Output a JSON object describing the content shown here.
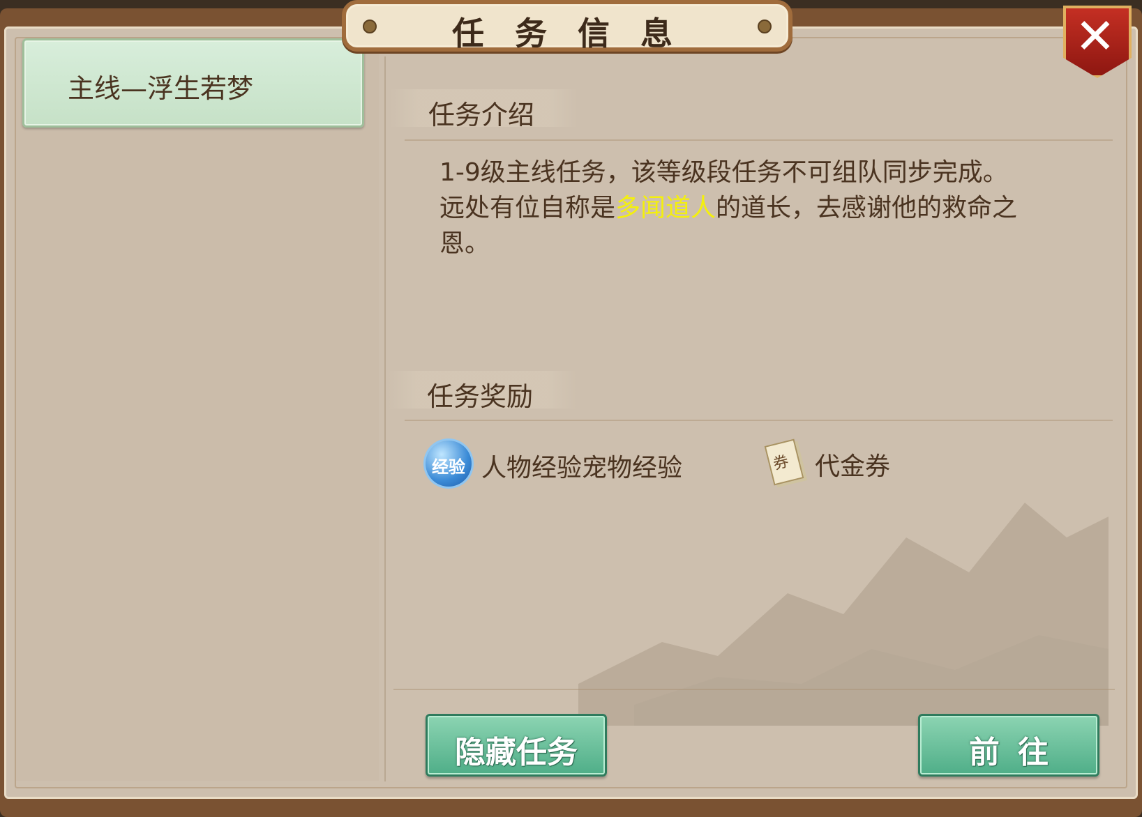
{
  "window": {
    "title": "任 务 信 息",
    "close_icon": "close-x-icon"
  },
  "quest_list": {
    "items": [
      {
        "label": "主线—浮生若梦",
        "selected": true
      }
    ]
  },
  "details": {
    "intro_header": "任务介绍",
    "intro_line1": "1-9级主线任务，该等级段任务不可组队同步完成。",
    "intro_line2_before": "远处有位自称是",
    "intro_highlight": "多闻道人",
    "intro_line2_after": "的道长，去感谢他的救命之",
    "intro_line3": "恩。",
    "rewards_header": "任务奖励",
    "rewards": [
      {
        "icon": "exp-orb-icon",
        "icon_text": "经验",
        "label": "人物经验宠物经验"
      },
      {
        "icon": "voucher-ticket-icon",
        "icon_text": "券",
        "label": "代金券"
      }
    ]
  },
  "actions": {
    "hide_label": "隐藏任务",
    "go_label": "前往"
  },
  "colors": {
    "highlight": "#f4f00c",
    "text": "#4a3320",
    "button": "#4fae88",
    "close": "#c42f23"
  }
}
